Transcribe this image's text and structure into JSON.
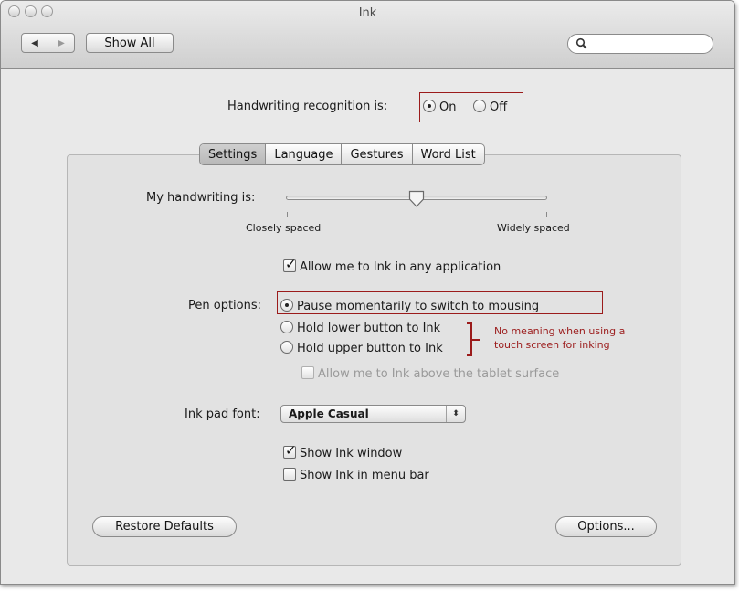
{
  "window": {
    "title": "Ink"
  },
  "toolbar": {
    "back_label": "◀",
    "forward_label": "▶",
    "show_all_label": "Show All",
    "search_placeholder": ""
  },
  "recognition": {
    "label": "Handwriting recognition is:",
    "on_label": "On",
    "off_label": "Off",
    "selected": "On"
  },
  "tabs": [
    {
      "label": "Settings",
      "selected": true
    },
    {
      "label": "Language"
    },
    {
      "label": "Gestures"
    },
    {
      "label": "Word List"
    }
  ],
  "settings": {
    "handwriting_label": "My handwriting is:",
    "slider_left_label": "Closely spaced",
    "slider_right_label": "Widely spaced",
    "slider_value": 0.5,
    "allow_any_app_label": "Allow me to Ink in any application",
    "allow_any_app_checked": true,
    "pen_options_label": "Pen options:",
    "pen_options": [
      {
        "label": "Pause momentarily to switch to mousing",
        "selected": true
      },
      {
        "label": "Hold lower button to Ink",
        "selected": false
      },
      {
        "label": "Hold upper button to Ink",
        "selected": false
      }
    ],
    "above_tablet_label": "Allow me to Ink above the tablet surface",
    "above_tablet_enabled": false,
    "ink_pad_font_label": "Ink pad font:",
    "ink_pad_font_value": "Apple Casual",
    "show_ink_window_label": "Show Ink window",
    "show_ink_window_checked": true,
    "show_in_menu_bar_label": "Show Ink in menu bar",
    "show_in_menu_bar_checked": false,
    "restore_defaults_label": "Restore Defaults",
    "options_label": "Options..."
  },
  "annotation": {
    "note_line1": "No meaning when using a",
    "note_line2": "touch screen for inking",
    "color": "#9b1b1b"
  }
}
